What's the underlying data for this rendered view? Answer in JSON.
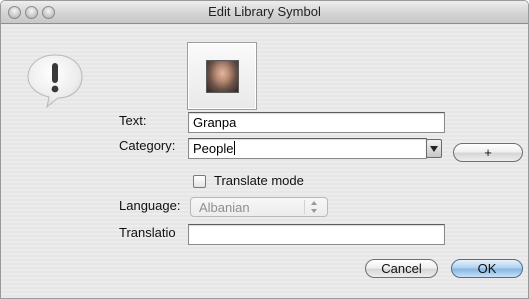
{
  "window": {
    "title": "Edit Library Symbol"
  },
  "icons": {
    "alert": "exclamation-icon",
    "traffic_lights": [
      "close-icon",
      "minimize-icon",
      "zoom-icon"
    ]
  },
  "symbol": {
    "image": "portrait-photo"
  },
  "form": {
    "text_label": "Text:",
    "text_value": "Granpa",
    "category_label": "Category:",
    "category_value": "People",
    "add_label": "+",
    "translate_label": "Translate mode",
    "translate_checked": false,
    "language_label": "Language:",
    "language_value": "Albanian",
    "translation_label": "Translatio",
    "translation_value": ""
  },
  "buttons": {
    "cancel": "Cancel",
    "ok": "OK"
  },
  "colors": {
    "default_button": "#86b7e3"
  }
}
